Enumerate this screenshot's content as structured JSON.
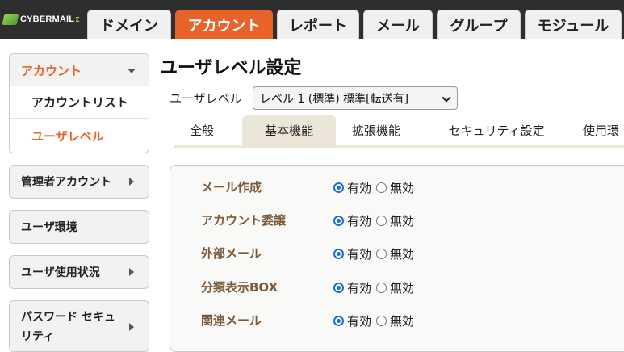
{
  "brand": {
    "name": "CYBERMAIL",
    "sup": "Σ"
  },
  "nav": {
    "tabs": [
      {
        "label": "ドメイン"
      },
      {
        "label": "アカウント"
      },
      {
        "label": "レポート"
      },
      {
        "label": "メール"
      },
      {
        "label": "グループ"
      },
      {
        "label": "モジュール"
      }
    ],
    "active": "アカウント"
  },
  "sidebar": {
    "account": {
      "label": "アカウント"
    },
    "sub_items": [
      {
        "label": "アカウントリスト"
      },
      {
        "label": "ユーザレベル"
      }
    ],
    "items": [
      {
        "label": "管理者アカウント"
      },
      {
        "label": "ユーザ環境"
      },
      {
        "label": "ユーザ使用状況"
      },
      {
        "label": "パスワード セキュ"
      },
      {
        "label": "リティ"
      }
    ]
  },
  "main": {
    "title": "ユーザレベル設定",
    "level_label": "ユーザレベル",
    "level_value": "レベル 1 (標準) 標準[転送有]",
    "tabs": [
      {
        "label": "全般"
      },
      {
        "label": "基本機能"
      },
      {
        "label": "拡張機能"
      },
      {
        "label": "セキュリティ設定"
      },
      {
        "label": "使用環"
      }
    ],
    "active_tab": "基本機能",
    "rows": [
      {
        "label": "メール作成"
      },
      {
        "label": "アカウント委譲"
      },
      {
        "label": "外部メール"
      },
      {
        "label": "分類表示BOX"
      },
      {
        "label": "関連メール"
      }
    ],
    "option_on": "有効",
    "option_off": "無効"
  },
  "colors": {
    "accent": "#e8632a",
    "topbar": "#2e2e2e",
    "label_brown": "#7a5a3a",
    "radio_blue": "#1a6fd1"
  }
}
